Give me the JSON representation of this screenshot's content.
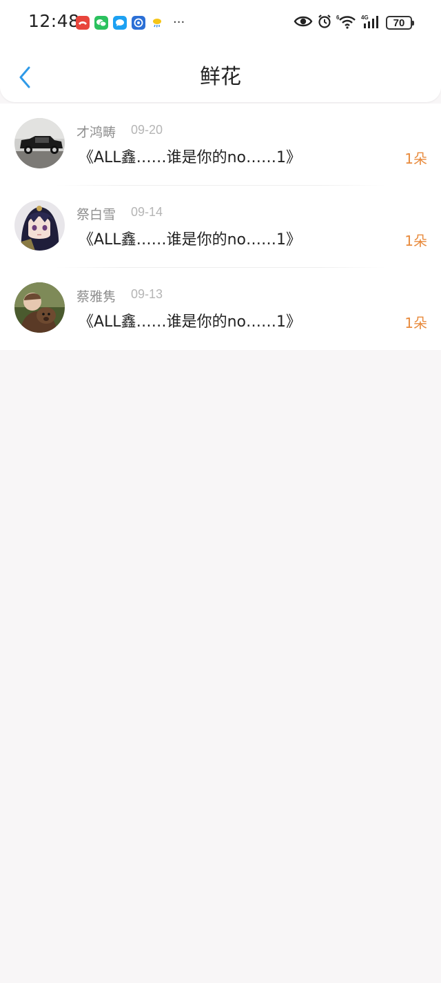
{
  "status_bar": {
    "time": "12:48",
    "notification_icons": [
      "missed-call-icon",
      "wechat-icon",
      "message-icon",
      "browser-icon",
      "weather-icon"
    ],
    "more": "···",
    "battery_level": "70"
  },
  "header": {
    "title": "鲜花"
  },
  "items": [
    {
      "user": "才鸿畴",
      "date": "09-20",
      "title": "《ALL鑫……谁是你的no……1》",
      "count": "1朵"
    },
    {
      "user": "祭白雪",
      "date": "09-14",
      "title": "《ALL鑫……谁是你的no……1》",
      "count": "1朵"
    },
    {
      "user": "蔡雅隽",
      "date": "09-13",
      "title": "《ALL鑫……谁是你的no……1》",
      "count": "1朵"
    }
  ],
  "colors": {
    "accent": "#2f9ae8",
    "flower_count": "#e88a3c",
    "background": "#f8f6f7"
  }
}
